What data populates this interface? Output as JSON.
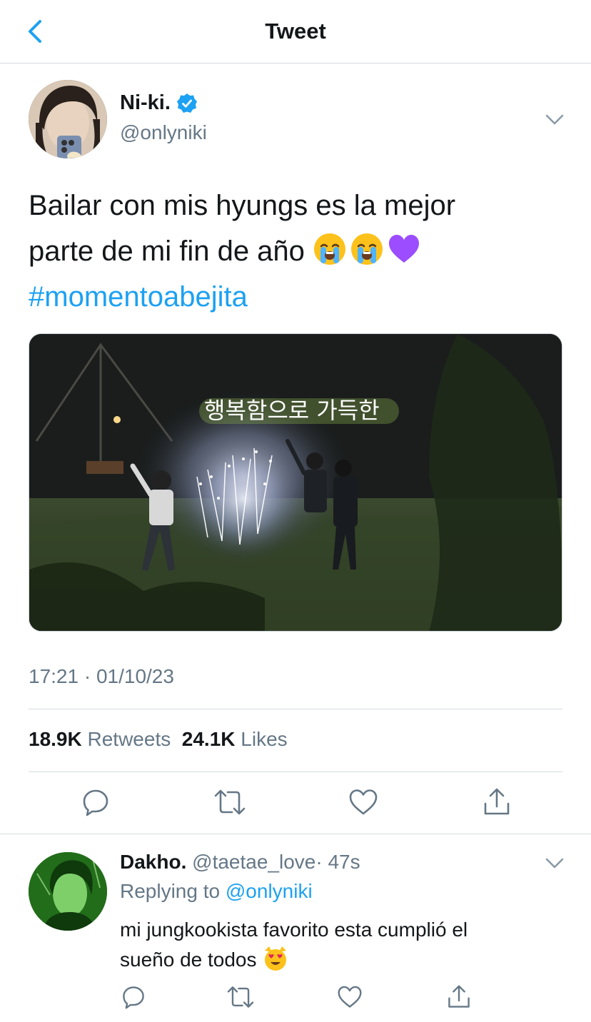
{
  "header": {
    "title": "Tweet"
  },
  "tweet": {
    "author_name": "Ni-ki.",
    "handle": "@onlyniki",
    "text_line1": "Bailar con mis hyungs es la mejor",
    "text_line2": "parte de mi fin de año",
    "emojis": [
      "loudly-crying-face",
      "loudly-crying-face",
      "purple-heart"
    ],
    "hashtag": "#momentoabejita",
    "media_caption": "행복함으로 가득한",
    "timestamp": "17:21 · 01/10/23",
    "retweets_count": "18.9K",
    "retweets_label": "Retweets",
    "likes_count": "24.1K",
    "likes_label": "Likes"
  },
  "reply": {
    "author_name": "Dakho.",
    "handle": "@taetae_love",
    "time": "· 47s",
    "replying_label": "Replying to",
    "replying_to": "@onlyniki",
    "text_line1": "mi jungkookista favorito esta cumplió el",
    "text_line2": "sueño de todos",
    "emoji": "smiling-cat-with-heart-eyes"
  },
  "colors": {
    "accent": "#1da1f2",
    "text": "#14171a",
    "secondary": "#657786",
    "divider": "#d6dbdf"
  }
}
